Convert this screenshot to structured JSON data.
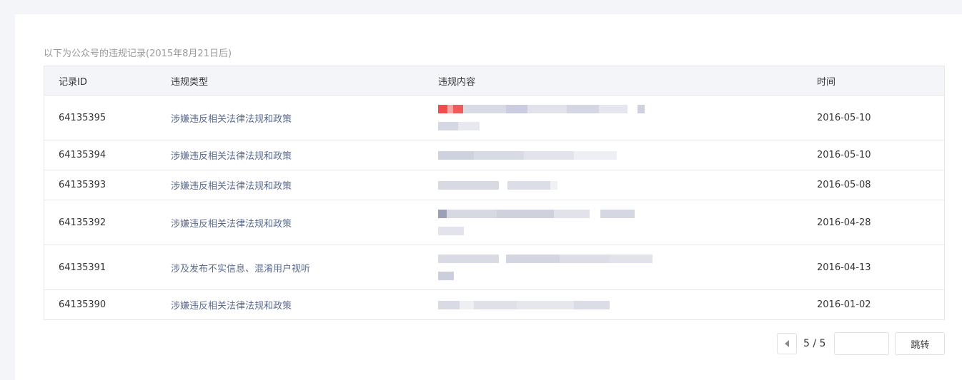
{
  "caption": "以下为公众号的违规记录(2015年8月21日后)",
  "table": {
    "headers": [
      "记录ID",
      "违规类型",
      "违规内容",
      "时间"
    ],
    "rows": [
      {
        "id": "64135395",
        "type": "涉嫌违反相关法律法规和政策",
        "date": "2016-05-10"
      },
      {
        "id": "64135394",
        "type": "涉嫌违反相关法律法规和政策",
        "date": "2016-05-10"
      },
      {
        "id": "64135393",
        "type": "涉嫌违反相关法律法规和政策",
        "date": "2016-05-08"
      },
      {
        "id": "64135392",
        "type": "涉嫌违反相关法律法规和政策",
        "date": "2016-04-28"
      },
      {
        "id": "64135391",
        "type": "涉及发布不实信息、混淆用户视听",
        "date": "2016-04-13"
      },
      {
        "id": "64135390",
        "type": "涉嫌违反相关法律法规和政策",
        "date": "2016-01-02"
      }
    ]
  },
  "pager": {
    "page_text": "5 / 5",
    "jump_input_value": "",
    "jump_label": "跳转"
  },
  "colors": {
    "redacted_accent": "#f24d4d",
    "redacted_gray": "#d3d6e0"
  }
}
